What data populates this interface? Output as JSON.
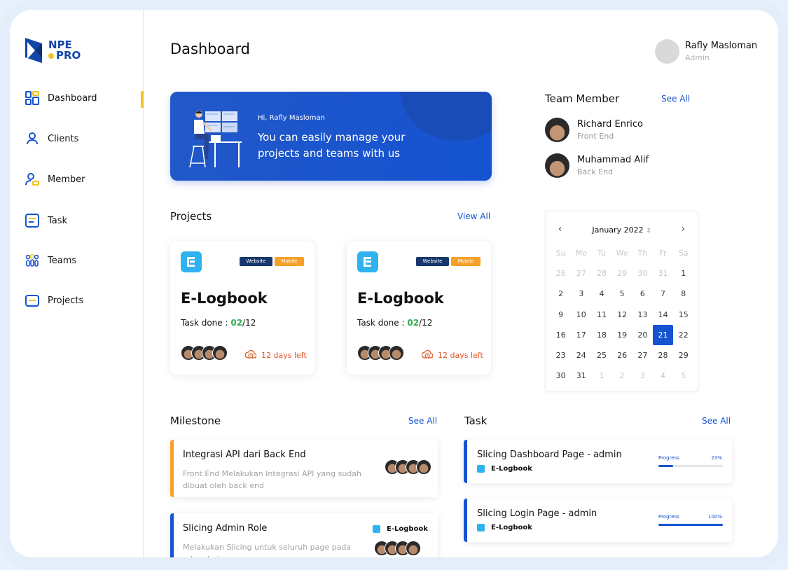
{
  "sidebar": {
    "logo": {
      "line1": "NPE",
      "line2": "PRO"
    },
    "items": [
      {
        "label": "Dashboard",
        "icon": "dashboard-icon",
        "active": true
      },
      {
        "label": "Clients",
        "icon": "user-icon"
      },
      {
        "label": "Member",
        "icon": "member-icon"
      },
      {
        "label": "Task",
        "icon": "task-icon"
      },
      {
        "label": "Teams",
        "icon": "teams-icon"
      },
      {
        "label": "Projects",
        "icon": "folder-icon"
      }
    ],
    "accent": "#f4c320"
  },
  "header": {
    "title": "Dashboard",
    "user": {
      "name": "Rafly Masloman",
      "role": "Admin"
    }
  },
  "banner": {
    "greeting": "Hi, Rafly Masloman",
    "message": "You can easily manage your projects and teams with us",
    "color": "#1553d1"
  },
  "projects": {
    "title": "Projects",
    "view_all": "View All",
    "cards": [
      {
        "name": "E-Logbook",
        "tags": [
          "Website",
          "Mobile"
        ],
        "task_label": "Task done : ",
        "done": "02",
        "total": "/12",
        "deadline": "12 days left"
      },
      {
        "name": "E-Logbook",
        "tags": [
          "Website",
          "Mobile"
        ],
        "task_label": "Task done : ",
        "done": "02",
        "total": "/12",
        "deadline": "12 days left"
      }
    ]
  },
  "team": {
    "title": "Team Member",
    "see_all": "See All",
    "members": [
      {
        "name": "Richard Enrico",
        "role": "Front End"
      },
      {
        "name": "Muhammad Alif",
        "role": "Back End"
      }
    ]
  },
  "calendar": {
    "month": "January 2022",
    "weekdays": [
      "Su",
      "Mo",
      "Tu",
      "We",
      "Th",
      "Fr",
      "Sa"
    ],
    "days": [
      {
        "d": "26",
        "muted": true
      },
      {
        "d": "27",
        "muted": true
      },
      {
        "d": "28",
        "muted": true
      },
      {
        "d": "29",
        "muted": true
      },
      {
        "d": "30",
        "muted": true
      },
      {
        "d": "31",
        "muted": true
      },
      {
        "d": "1"
      },
      {
        "d": "2"
      },
      {
        "d": "3"
      },
      {
        "d": "4"
      },
      {
        "d": "5"
      },
      {
        "d": "6"
      },
      {
        "d": "7"
      },
      {
        "d": "8"
      },
      {
        "d": "9"
      },
      {
        "d": "10"
      },
      {
        "d": "11"
      },
      {
        "d": "12"
      },
      {
        "d": "13"
      },
      {
        "d": "14"
      },
      {
        "d": "15"
      },
      {
        "d": "16"
      },
      {
        "d": "17"
      },
      {
        "d": "18"
      },
      {
        "d": "19"
      },
      {
        "d": "20"
      },
      {
        "d": "21",
        "selected": true
      },
      {
        "d": "22"
      },
      {
        "d": "23"
      },
      {
        "d": "24"
      },
      {
        "d": "25"
      },
      {
        "d": "26"
      },
      {
        "d": "27"
      },
      {
        "d": "28"
      },
      {
        "d": "29"
      },
      {
        "d": "30"
      },
      {
        "d": "31"
      },
      {
        "d": "1",
        "muted": true
      },
      {
        "d": "2",
        "muted": true
      },
      {
        "d": "3",
        "muted": true
      },
      {
        "d": "4",
        "muted": true
      },
      {
        "d": "5",
        "muted": true
      }
    ]
  },
  "milestone": {
    "title": "Milestone",
    "see_all": "See All",
    "items": [
      {
        "title": "Integrasi API dari Back End",
        "desc": "Front End Melakukan Integrasi API yang sudah dibuat oleh back end",
        "color": "#f7a12a"
      },
      {
        "title": "Slicing Admin Role",
        "desc": "Melakukan Slicing untuk seluruh page pada role admin",
        "project": "E-Logbook",
        "color": "#1553d1"
      }
    ]
  },
  "task": {
    "title": "Task",
    "see_all": "See All",
    "items": [
      {
        "title": "Slicing Dashboard Page - admin",
        "project": "E-Logbook",
        "progress_label": "Progress",
        "progress_text": "23%",
        "progress": 0.23
      },
      {
        "title": "Slicing Login Page - admin",
        "project": "E-Logbook",
        "progress_label": "Progress",
        "progress_text": "100%",
        "progress": 1.0
      }
    ]
  }
}
